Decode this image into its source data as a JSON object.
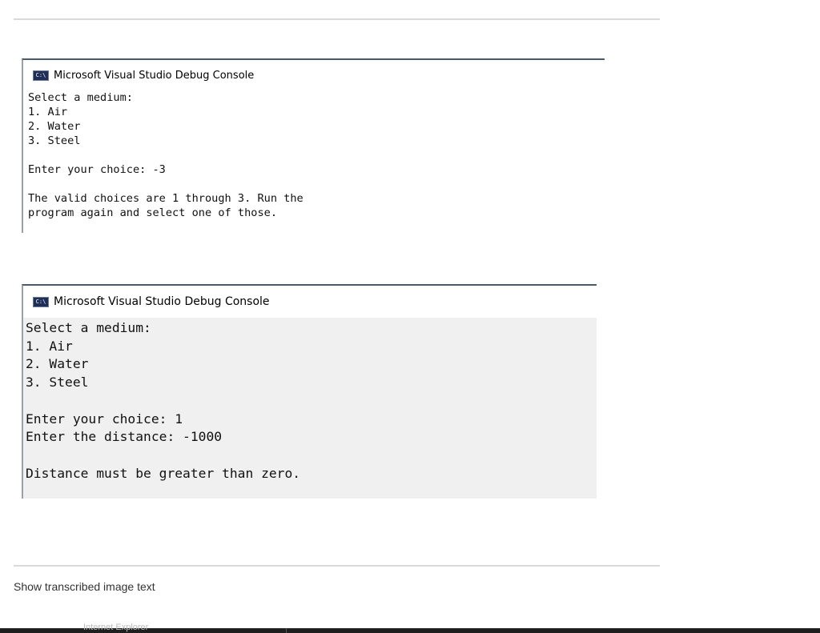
{
  "console_windows": [
    {
      "title": "Microsoft Visual Studio Debug Console",
      "icon": "console-app-icon",
      "icon_text": "C:\\",
      "lines": [
        "Select a medium:",
        "1. Air",
        "2. Water",
        "3. Steel",
        "",
        "Enter your choice: -3",
        "",
        "The valid choices are 1 through 3. Run the",
        "program again and select one of those."
      ]
    },
    {
      "title": "Microsoft Visual Studio Debug Console",
      "icon": "console-app-icon",
      "icon_text": "C:\\",
      "lines": [
        "Select a medium:",
        "1. Air",
        "2. Water",
        "3. Steel",
        "",
        "Enter your choice: 1",
        "Enter the distance: -1000",
        "",
        "Distance must be greater than zero."
      ]
    }
  ],
  "footer": {
    "show_transcribed_text": "Show transcribed image text"
  },
  "taskbar": {
    "item_label": "Internet Explorer"
  },
  "colors": {
    "console_icon_bg": "#1e2e56",
    "console_bg_2": "#f0f0f0",
    "divider": "#d9d9d9",
    "taskbar": "#1f1f1f"
  }
}
